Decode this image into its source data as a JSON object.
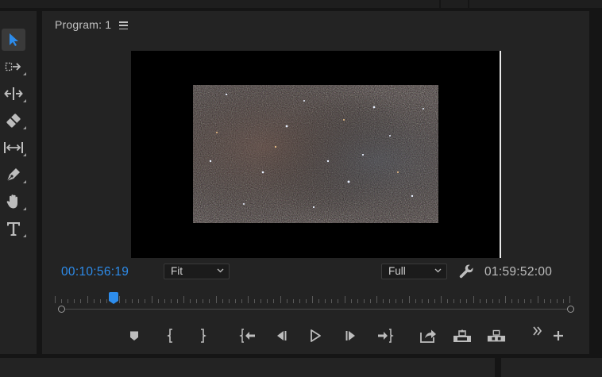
{
  "monitor": {
    "title": "Program: 1",
    "current_timecode": "00:10:56:19",
    "duration_timecode": "01:59:52:00",
    "zoom_select": {
      "selected": "Fit"
    },
    "resolution_select": {
      "selected": "Full"
    }
  },
  "tools": [
    {
      "name": "selection-tool",
      "icon": "arrow-icon",
      "active": true
    },
    {
      "name": "track-select-tool",
      "icon": "track-select-icon"
    },
    {
      "name": "ripple-edit-tool",
      "icon": "ripple-edit-icon"
    },
    {
      "name": "razor-tool",
      "icon": "razor-icon"
    },
    {
      "name": "slip-tool",
      "icon": "slip-icon"
    },
    {
      "name": "pen-tool",
      "icon": "pen-icon"
    },
    {
      "name": "hand-tool",
      "icon": "hand-icon"
    },
    {
      "name": "type-tool",
      "icon": "type-icon"
    }
  ],
  "transport": [
    "add-marker-icon",
    "mark-in-icon",
    "mark-out-icon",
    "go-to-in-icon",
    "step-back-icon",
    "play-icon",
    "step-forward-icon",
    "go-to-out-icon",
    "lift-icon",
    "extract-icon",
    "export-frame-icon",
    "more-icon",
    "add-button-icon"
  ],
  "colors": {
    "accent": "#2d8ceb",
    "panel": "#232323",
    "background": "#151515"
  }
}
